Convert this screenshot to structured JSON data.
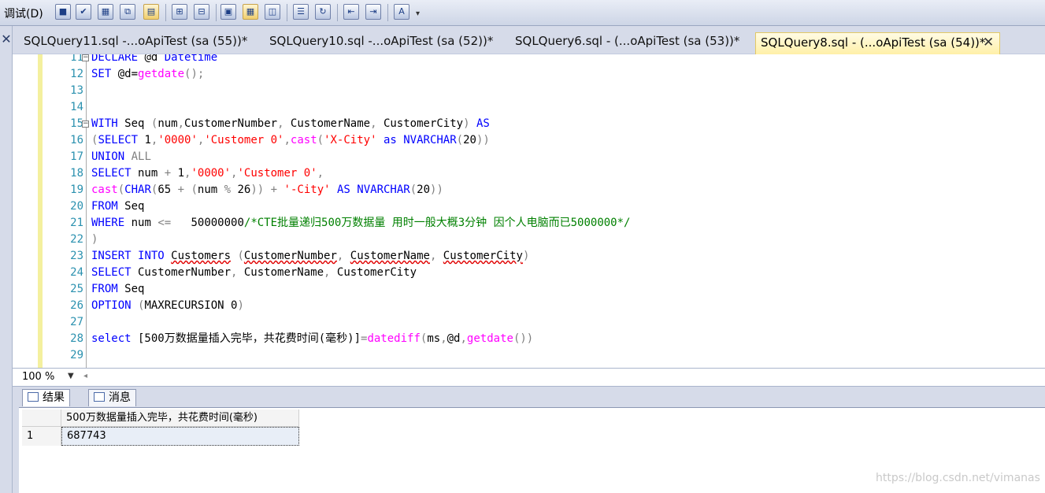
{
  "menu": {
    "debug_label": "调试(D)"
  },
  "tabs": [
    {
      "label": "SQLQuery11.sql -...oApiTest (sa (55))*"
    },
    {
      "label": "SQLQuery10.sql -...oApiTest (sa (52))*"
    },
    {
      "label": "SQLQuery6.sql - (...oApiTest (sa (53))*"
    },
    {
      "label": "SQLQuery8.sql - (...oApiTest (sa (54))*",
      "active": true
    }
  ],
  "editor": {
    "lines": [
      {
        "n": "11",
        "parts": [
          [
            "DECLARE",
            "kw"
          ],
          [
            " @d ",
            ""
          ],
          [
            "Datetime",
            "kw"
          ]
        ]
      },
      {
        "n": "12",
        "parts": [
          [
            "SET",
            "kw"
          ],
          [
            " @d=",
            ""
          ],
          [
            "getdate",
            "fn"
          ],
          [
            "();",
            "gray"
          ]
        ]
      },
      {
        "n": "13",
        "parts": []
      },
      {
        "n": "14",
        "parts": []
      },
      {
        "n": "15",
        "parts": [
          [
            "WITH",
            "kw"
          ],
          [
            " Seq ",
            ""
          ],
          [
            "(",
            "gray"
          ],
          [
            "num",
            ""
          ],
          [
            ",",
            "gray"
          ],
          [
            "CustomerNumber",
            ""
          ],
          [
            ", ",
            "gray"
          ],
          [
            "CustomerName",
            ""
          ],
          [
            ", ",
            "gray"
          ],
          [
            "CustomerCity",
            ""
          ],
          [
            ") ",
            "gray"
          ],
          [
            "AS",
            "kw"
          ]
        ]
      },
      {
        "n": "16",
        "parts": [
          [
            "(",
            "gray"
          ],
          [
            "SELECT",
            "kw"
          ],
          [
            " 1",
            ""
          ],
          [
            ",",
            "gray"
          ],
          [
            "'0000'",
            "str"
          ],
          [
            ",",
            "gray"
          ],
          [
            "'Customer 0'",
            "str"
          ],
          [
            ",",
            "gray"
          ],
          [
            "cast",
            "fn"
          ],
          [
            "(",
            "gray"
          ],
          [
            "'X-City'",
            "str"
          ],
          [
            " as ",
            "kw"
          ],
          [
            "NVARCHAR",
            "kw"
          ],
          [
            "(",
            "gray"
          ],
          [
            "20",
            ""
          ],
          [
            "))",
            "gray"
          ]
        ]
      },
      {
        "n": "17",
        "parts": [
          [
            "UNION",
            "kw"
          ],
          [
            " ALL",
            "gray"
          ]
        ]
      },
      {
        "n": "18",
        "parts": [
          [
            "SELECT",
            "kw"
          ],
          [
            " num ",
            ""
          ],
          [
            "+",
            "gray"
          ],
          [
            " 1",
            ""
          ],
          [
            ",",
            "gray"
          ],
          [
            "'0000'",
            "str"
          ],
          [
            ",",
            "gray"
          ],
          [
            "'Customer 0'",
            "str"
          ],
          [
            ",",
            "gray"
          ]
        ]
      },
      {
        "n": "19",
        "parts": [
          [
            "cast",
            "fn"
          ],
          [
            "(",
            "gray"
          ],
          [
            "CHAR",
            "kw"
          ],
          [
            "(",
            "gray"
          ],
          [
            "65 ",
            ""
          ],
          [
            "+",
            "gray"
          ],
          [
            " ",
            ""
          ],
          [
            "(",
            "gray"
          ],
          [
            "num ",
            ""
          ],
          [
            "%",
            "gray"
          ],
          [
            " 26",
            ""
          ],
          [
            "))",
            "gray"
          ],
          [
            " ",
            ""
          ],
          [
            "+",
            "gray"
          ],
          [
            " ",
            ""
          ],
          [
            "'-City'",
            "str"
          ],
          [
            " AS ",
            "kw"
          ],
          [
            "NVARCHAR",
            "kw"
          ],
          [
            "(",
            "gray"
          ],
          [
            "20",
            ""
          ],
          [
            "))",
            "gray"
          ]
        ]
      },
      {
        "n": "20",
        "parts": [
          [
            "FROM",
            "kw"
          ],
          [
            " Seq",
            ""
          ]
        ]
      },
      {
        "n": "21",
        "parts": [
          [
            "WHERE",
            "kw"
          ],
          [
            " num ",
            ""
          ],
          [
            "<=",
            "gray"
          ],
          [
            "   50000000",
            ""
          ],
          [
            "/*CTE批量递归500万数据量 用时一般大概3分钟 因个人电脑而已5000000*/",
            "cm"
          ]
        ]
      },
      {
        "n": "22",
        "parts": [
          [
            ")",
            "gray"
          ]
        ]
      },
      {
        "n": "23",
        "parts": [
          [
            "INSERT",
            "kw"
          ],
          [
            " ",
            ""
          ],
          [
            "INTO",
            "kw"
          ],
          [
            " ",
            ""
          ],
          [
            "Customers",
            "sq"
          ],
          [
            " ",
            ""
          ],
          [
            "(",
            "gray"
          ],
          [
            "CustomerNumber",
            "sq"
          ],
          [
            ", ",
            "gray"
          ],
          [
            "CustomerName",
            "sq"
          ],
          [
            ", ",
            "gray"
          ],
          [
            "CustomerCity",
            "sq"
          ],
          [
            ")",
            "gray"
          ]
        ]
      },
      {
        "n": "24",
        "parts": [
          [
            "SELECT",
            "kw"
          ],
          [
            " CustomerNumber",
            ""
          ],
          [
            ", ",
            "gray"
          ],
          [
            "CustomerName",
            ""
          ],
          [
            ", ",
            "gray"
          ],
          [
            "CustomerCity",
            ""
          ]
        ]
      },
      {
        "n": "25",
        "parts": [
          [
            "FROM",
            "kw"
          ],
          [
            " Seq",
            ""
          ]
        ]
      },
      {
        "n": "26",
        "parts": [
          [
            "OPTION",
            "kw"
          ],
          [
            " ",
            ""
          ],
          [
            "(",
            "gray"
          ],
          [
            "MAXRECURSION 0",
            ""
          ],
          [
            ")",
            "gray"
          ]
        ]
      },
      {
        "n": "27",
        "parts": []
      },
      {
        "n": "28",
        "parts": [
          [
            "select",
            "kw"
          ],
          [
            " [500万数据量插入完毕，共花费时间(毫秒)]",
            ""
          ],
          [
            "=",
            "gray"
          ],
          [
            "datediff",
            "fn"
          ],
          [
            "(",
            "gray"
          ],
          [
            "ms",
            ""
          ],
          [
            ",",
            "gray"
          ],
          [
            "@d",
            ""
          ],
          [
            ",",
            "gray"
          ],
          [
            "getdate",
            "fn"
          ],
          [
            "())",
            "gray"
          ]
        ]
      },
      {
        "n": "29",
        "parts": []
      }
    ]
  },
  "zoom": {
    "value": "100 %"
  },
  "results_tabs": {
    "results": "结果",
    "messages": "消息"
  },
  "results": {
    "column_header": "500万数据量插入完毕，共花费时间(毫秒)",
    "row_number": "1",
    "value": "687743"
  },
  "watermark": "https://blog.csdn.net/vimanas"
}
